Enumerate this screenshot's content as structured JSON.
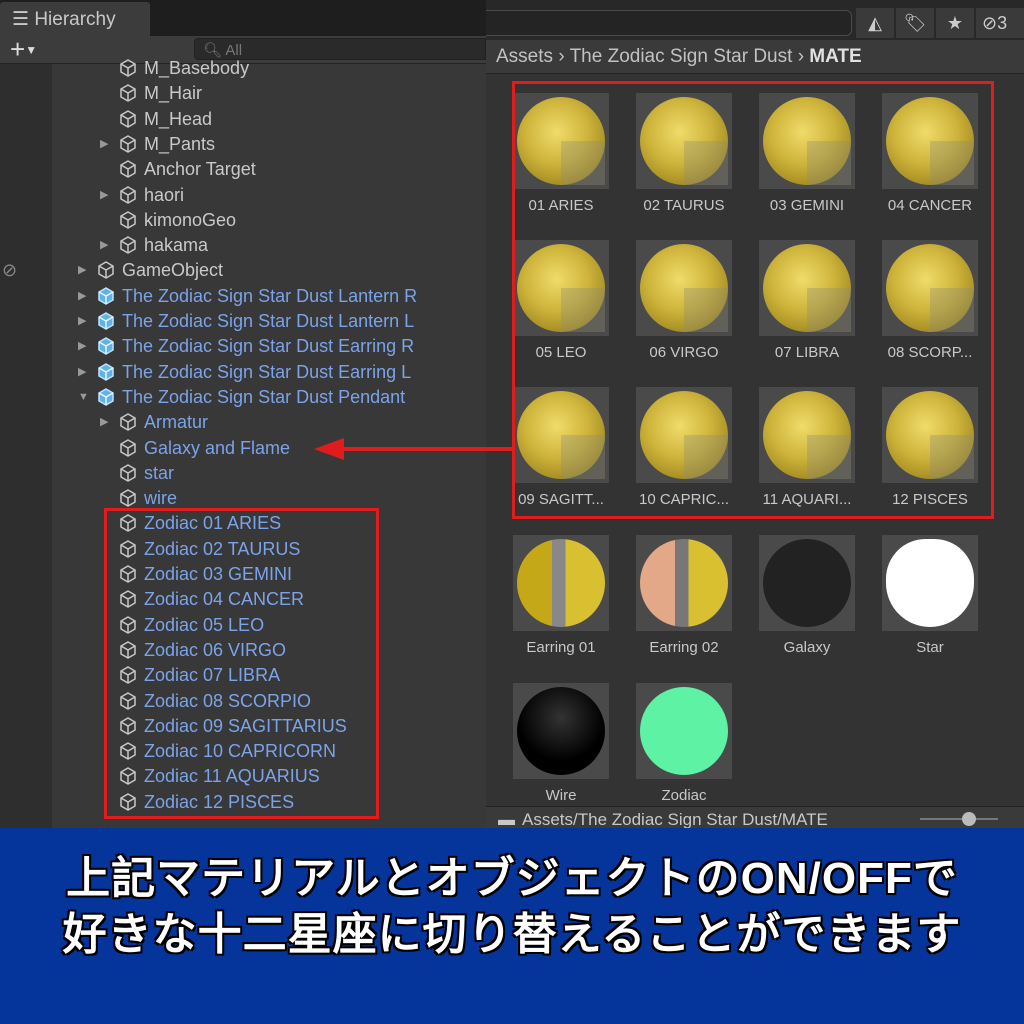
{
  "hierarchy": {
    "tab": "Hierarchy",
    "search_placeholder": "All",
    "rows": [
      {
        "label": "M_Basebody",
        "level": 2,
        "arrow": false,
        "blue": false
      },
      {
        "label": "M_Hair",
        "level": 2,
        "arrow": false,
        "blue": false
      },
      {
        "label": "M_Head",
        "level": 2,
        "arrow": false,
        "blue": false
      },
      {
        "label": "M_Pants",
        "level": 2,
        "arrow": true,
        "blue": false
      },
      {
        "label": "Anchor Target",
        "level": 2,
        "arrow": false,
        "blue": false
      },
      {
        "label": "haori",
        "level": 2,
        "arrow": true,
        "blue": false
      },
      {
        "label": "kimonoGeo",
        "level": 2,
        "arrow": false,
        "blue": false
      },
      {
        "label": "hakama",
        "level": 2,
        "arrow": true,
        "blue": false
      },
      {
        "label": "GameObject",
        "level": 1,
        "arrow": true,
        "blue": false
      },
      {
        "label": "The Zodiac Sign Star Dust Lantern R",
        "level": 1,
        "arrow": true,
        "blue": true,
        "prefab": true
      },
      {
        "label": "The Zodiac Sign Star Dust Lantern L",
        "level": 1,
        "arrow": true,
        "blue": true,
        "prefab": true
      },
      {
        "label": "The Zodiac Sign Star Dust Earring R",
        "level": 1,
        "arrow": true,
        "blue": true,
        "prefab": true
      },
      {
        "label": "The Zodiac Sign Star Dust Earring L",
        "level": 1,
        "arrow": true,
        "blue": true,
        "prefab": true
      },
      {
        "label": "The Zodiac Sign Star Dust Pendant",
        "level": 1,
        "arrow": true,
        "expanded": true,
        "blue": true,
        "prefab": true
      },
      {
        "label": "Armatur",
        "level": 2,
        "arrow": true,
        "blue": true
      },
      {
        "label": "Galaxy and Flame",
        "level": 2,
        "arrow": false,
        "blue": true
      },
      {
        "label": "star",
        "level": 2,
        "arrow": false,
        "blue": true
      },
      {
        "label": "wire",
        "level": 2,
        "arrow": false,
        "blue": true
      },
      {
        "label": "Zodiac 01 ARIES",
        "level": 2,
        "arrow": false,
        "blue": true
      },
      {
        "label": "Zodiac 02 TAURUS",
        "level": 2,
        "arrow": false,
        "blue": true
      },
      {
        "label": "Zodiac 03 GEMINI",
        "level": 2,
        "arrow": false,
        "blue": true
      },
      {
        "label": "Zodiac 04 CANCER",
        "level": 2,
        "arrow": false,
        "blue": true
      },
      {
        "label": "Zodiac 05 LEO",
        "level": 2,
        "arrow": false,
        "blue": true
      },
      {
        "label": "Zodiac 06 VIRGO",
        "level": 2,
        "arrow": false,
        "blue": true
      },
      {
        "label": "Zodiac 07 LIBRA",
        "level": 2,
        "arrow": false,
        "blue": true
      },
      {
        "label": "Zodiac 08 SCORPIO",
        "level": 2,
        "arrow": false,
        "blue": true
      },
      {
        "label": "Zodiac 09 SAGITTARIUS",
        "level": 2,
        "arrow": false,
        "blue": true
      },
      {
        "label": "Zodiac 10 CAPRICORN",
        "level": 2,
        "arrow": false,
        "blue": true
      },
      {
        "label": "Zodiac 11 AQUARIUS",
        "level": 2,
        "arrow": false,
        "blue": true
      },
      {
        "label": "Zodiac 12 PISCES",
        "level": 2,
        "arrow": false,
        "blue": true
      }
    ]
  },
  "project": {
    "hidden_count": "3",
    "breadcrumb": [
      "Assets",
      "The Zodiac Sign Star Dust",
      "MATE"
    ],
    "materials": [
      {
        "label": "01 ARIES",
        "kind": "gold"
      },
      {
        "label": "02 TAURUS",
        "kind": "gold"
      },
      {
        "label": "03 GEMINI",
        "kind": "gold"
      },
      {
        "label": "04 CANCER",
        "kind": "gold"
      },
      {
        "label": "05 LEO",
        "kind": "gold"
      },
      {
        "label": "06 VIRGO",
        "kind": "gold"
      },
      {
        "label": "07 LIBRA",
        "kind": "gold"
      },
      {
        "label": "08 SCORP...",
        "kind": "gold"
      },
      {
        "label": "09 SAGITT...",
        "kind": "gold"
      },
      {
        "label": "10 CAPRIC...",
        "kind": "gold"
      },
      {
        "label": "11 AQUARI...",
        "kind": "gold"
      },
      {
        "label": "12 PISCES",
        "kind": "gold"
      },
      {
        "label": "Earring 01",
        "kind": "earring1"
      },
      {
        "label": "Earring 02",
        "kind": "earring2"
      },
      {
        "label": "Galaxy",
        "kind": "galaxy"
      },
      {
        "label": "Star",
        "kind": "star"
      },
      {
        "label": "Wire",
        "kind": "wire"
      },
      {
        "label": "Zodiac",
        "kind": "zodiac"
      }
    ],
    "status_path": "Assets/The Zodiac Sign Star Dust/MATE"
  },
  "banner": {
    "line1": "上記マテリアルとオブジェクトのON/OFFで",
    "line2": "好きな十二星座に切り替えることができます"
  },
  "colors": {
    "highlight": "#e01c1c",
    "banner": "#05349a",
    "prefab_text": "#7ba3e8"
  }
}
